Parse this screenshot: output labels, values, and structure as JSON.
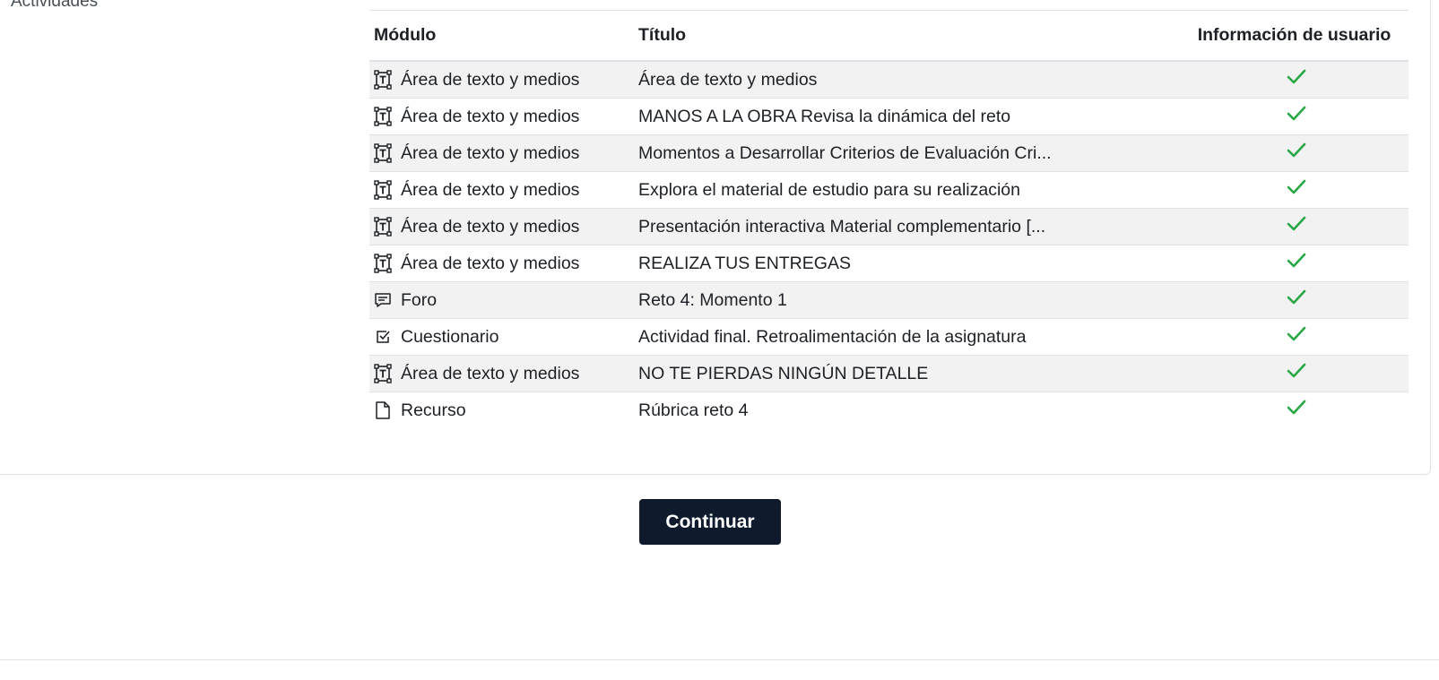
{
  "section": {
    "label": "Actividades"
  },
  "table": {
    "headers": {
      "module": "Módulo",
      "title": "Título",
      "user_info": "Información de usuario"
    },
    "rows": [
      {
        "module": "Área de texto y medios",
        "icon": "text-media-icon",
        "title": "Área de texto y medios",
        "status": "check-icon"
      },
      {
        "module": "Área de texto y medios",
        "icon": "text-media-icon",
        "title": "MANOS A LA OBRA Revisa la dinámica del reto",
        "status": "check-icon"
      },
      {
        "module": "Área de texto y medios",
        "icon": "text-media-icon",
        "title": "Momentos a Desarrollar Criterios de Evaluación Cri...",
        "status": "check-icon"
      },
      {
        "module": "Área de texto y medios",
        "icon": "text-media-icon",
        "title": "Explora el material de estudio para su realización",
        "status": "check-icon"
      },
      {
        "module": "Área de texto y medios",
        "icon": "text-media-icon",
        "title": "Presentación interactiva Material complementario [...",
        "status": "check-icon"
      },
      {
        "module": "Área de texto y medios",
        "icon": "text-media-icon",
        "title": "REALIZA TUS ENTREGAS",
        "status": "check-icon"
      },
      {
        "module": "Foro",
        "icon": "forum-icon",
        "title": "Reto 4: Momento 1",
        "status": "check-icon"
      },
      {
        "module": "Cuestionario",
        "icon": "quiz-icon",
        "title": "Actividad final. Retroalimentación de la asignatura",
        "status": "check-icon"
      },
      {
        "module": "Área de texto y medios",
        "icon": "text-media-icon",
        "title": "NO TE PIERDAS NINGÚN DETALLE",
        "status": "check-icon"
      },
      {
        "module": "Recurso",
        "icon": "resource-icon",
        "title": "Rúbrica reto 4",
        "status": "check-icon"
      }
    ]
  },
  "actions": {
    "continue_label": "Continuar"
  },
  "colors": {
    "check": "#28a745",
    "button_bg": "#0f1b2d",
    "row_stripe": "#f2f2f2"
  }
}
